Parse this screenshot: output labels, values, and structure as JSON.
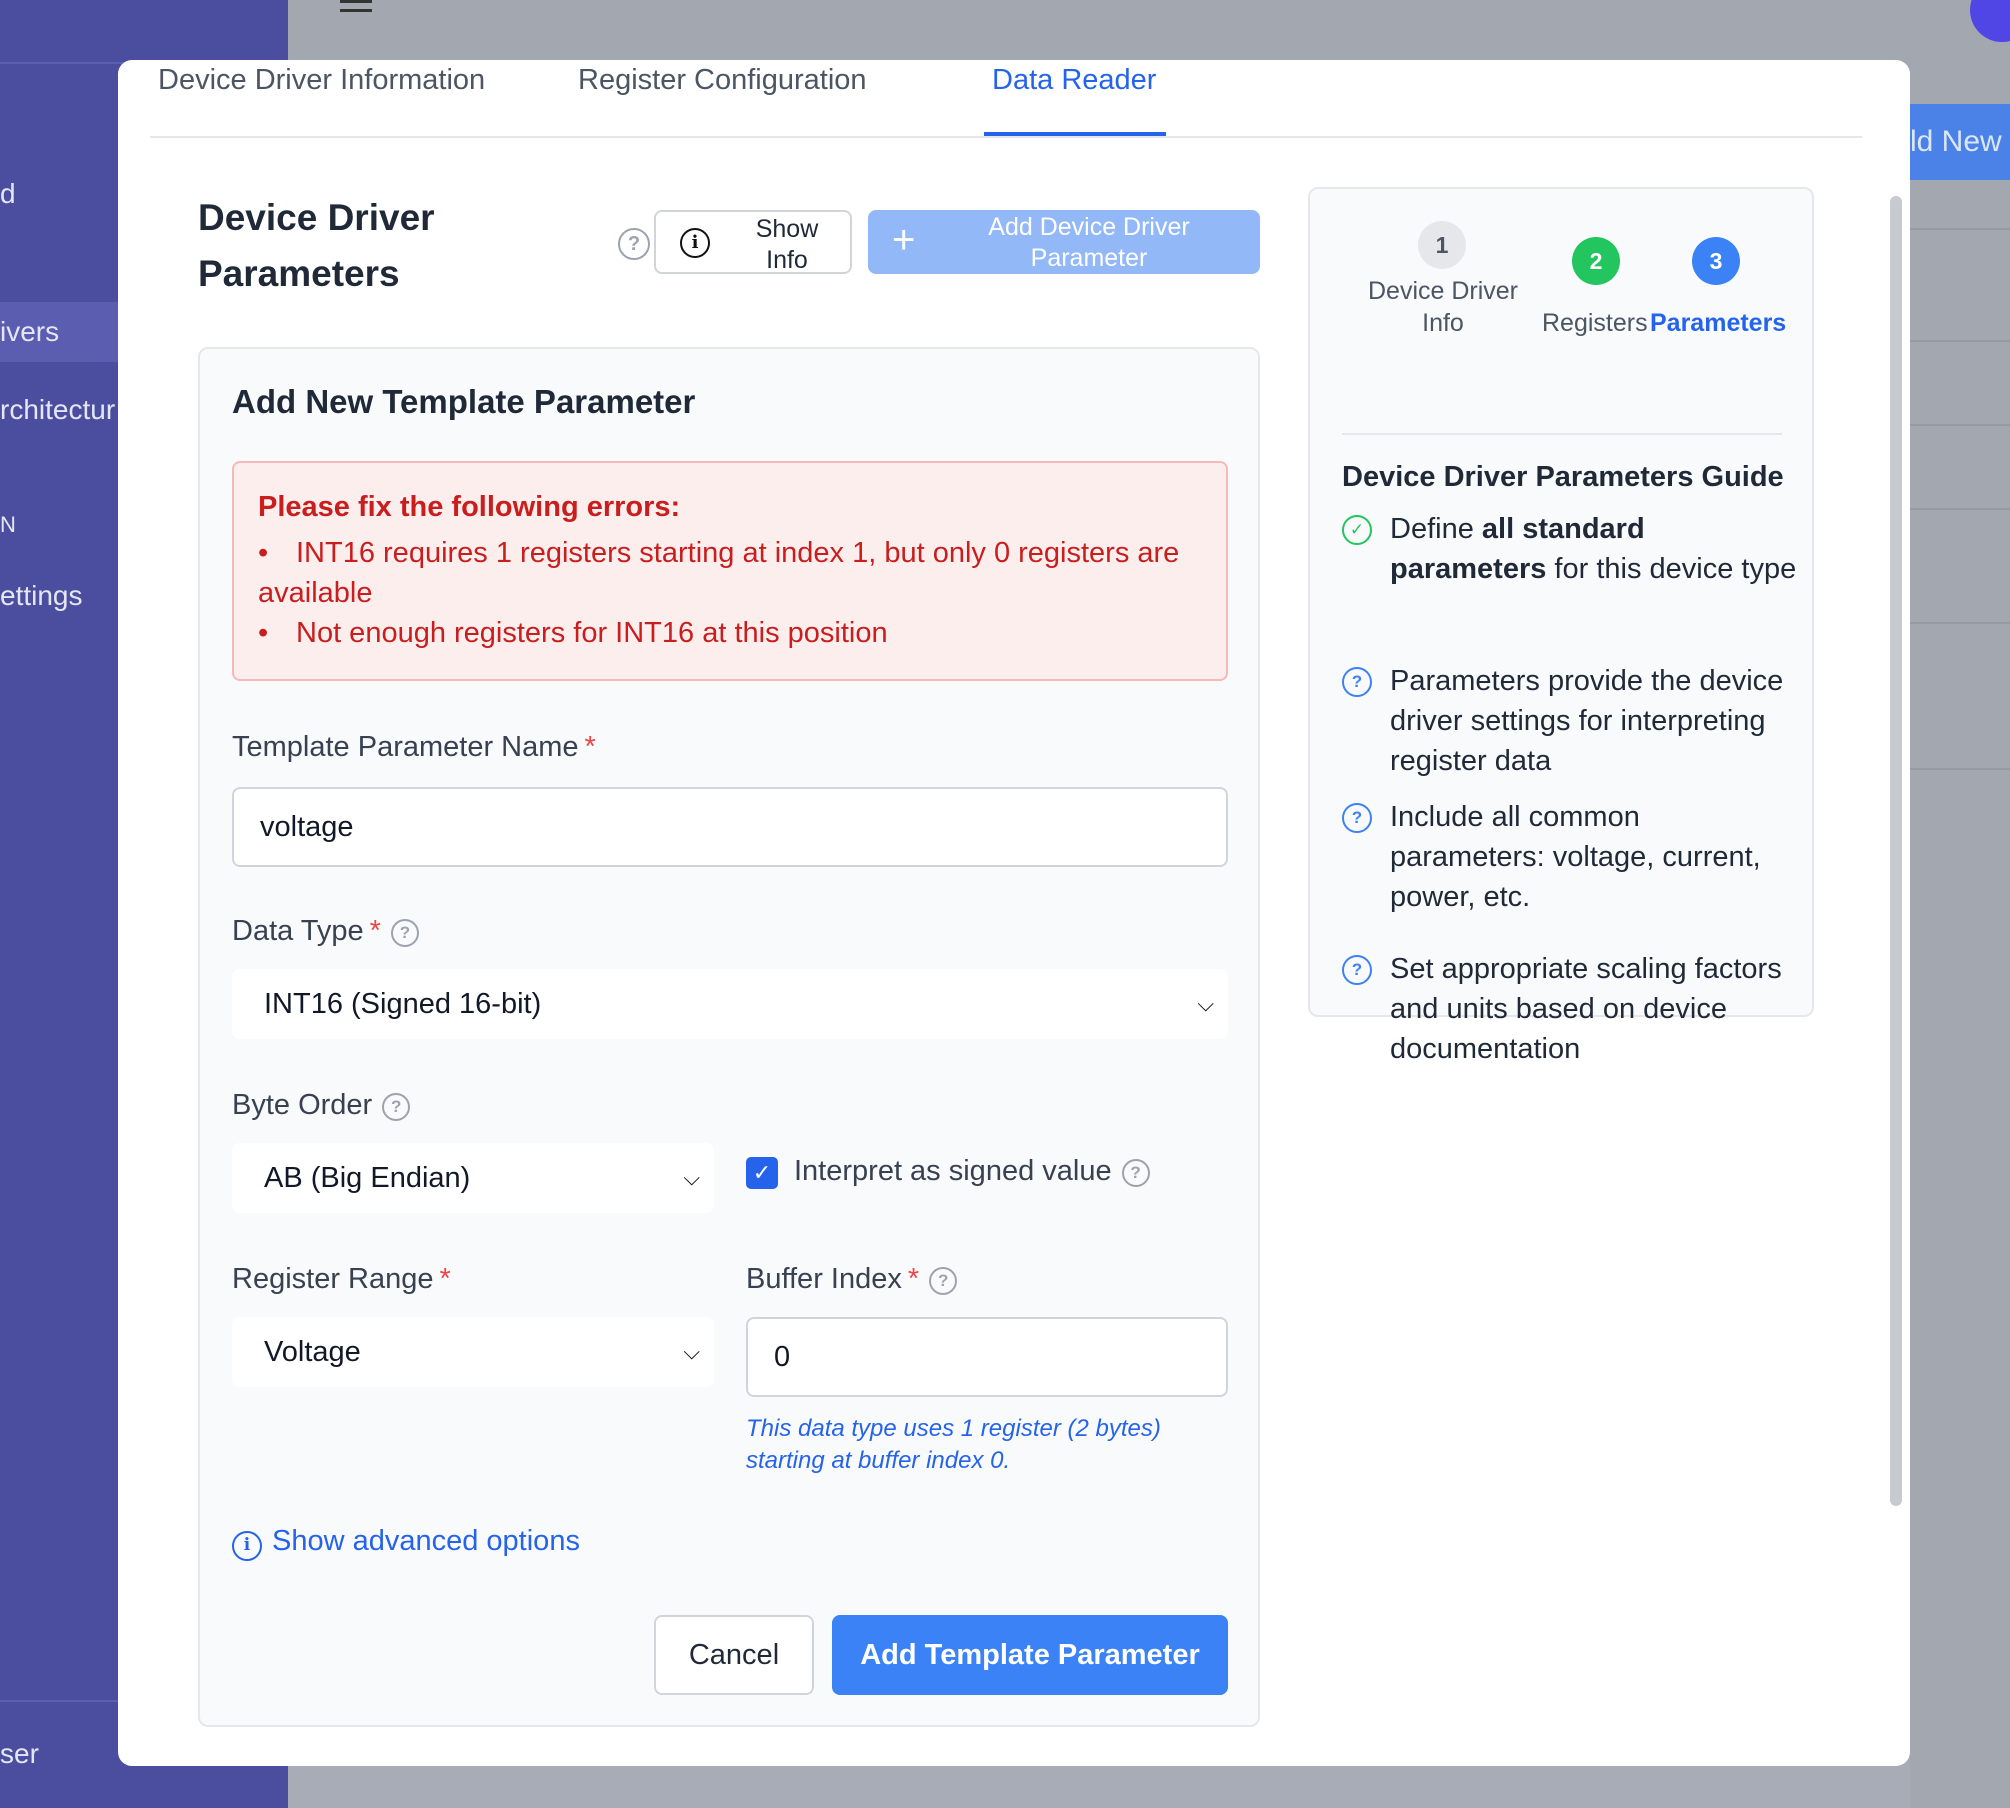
{
  "background": {
    "sidebar_items": [
      "d",
      "ivers",
      "rchitectur",
      "N",
      "ettings",
      "ser"
    ],
    "add_new_label": "ld New"
  },
  "tabs": [
    {
      "label": "Device Driver Information",
      "active": false
    },
    {
      "label": "Register Configuration",
      "active": false
    },
    {
      "label": "Data Reader",
      "active": true
    }
  ],
  "header": {
    "title": "Device Driver Parameters",
    "help_glyph": "?",
    "show_info_label": "Show Info",
    "add_button_label": "Add Device Driver Parameter"
  },
  "form": {
    "title": "Add New Template Parameter",
    "errors": {
      "title": "Please fix the following errors:",
      "items": [
        "INT16 requires 1 registers starting at index 1, but only 0 registers are available",
        "Not enough registers for INT16 at this position"
      ]
    },
    "name_label": "Template Parameter Name",
    "name_value": "voltage",
    "required_mark": "*",
    "data_type_label": "Data Type",
    "data_type_value": "INT16 (Signed 16-bit)",
    "byte_order_label": "Byte Order",
    "byte_order_value": "AB (Big Endian)",
    "signed_label": "Interpret as signed value",
    "signed_checked": true,
    "register_range_label": "Register Range",
    "register_range_value": "Voltage",
    "buffer_index_label": "Buffer Index",
    "buffer_index_value": "0",
    "buffer_hint": "This data type uses 1 register (2 bytes) starting at buffer index 0.",
    "advanced_link": "Show advanced options",
    "cancel_label": "Cancel",
    "submit_label": "Add Template Parameter"
  },
  "guide": {
    "steps": [
      {
        "number": "1",
        "label": "Device Driver Info",
        "state": "pending",
        "color": "#e5e7eb"
      },
      {
        "number": "2",
        "label": "Registers",
        "state": "done",
        "color": "#22c55e"
      },
      {
        "number": "3",
        "label": "Parameters",
        "state": "current",
        "color": "#3b82f6"
      }
    ],
    "title": "Device Driver Parameters Guide",
    "items": [
      {
        "icon": "check-circle-icon",
        "prefix": "Define ",
        "bold": "all standard parameters",
        "suffix": " for this device type"
      },
      {
        "icon": "help-circle-icon",
        "text": "Parameters provide the device driver settings for interpreting register data"
      },
      {
        "icon": "help-circle-icon",
        "text": "Include all common parameters: voltage, current, power, etc."
      },
      {
        "icon": "help-circle-icon",
        "text": "Set appropriate scaling factors and units based on device documentation"
      }
    ]
  },
  "colors": {
    "accent": "#2563eb",
    "error": "#c81e1e",
    "success": "#22c55e"
  }
}
